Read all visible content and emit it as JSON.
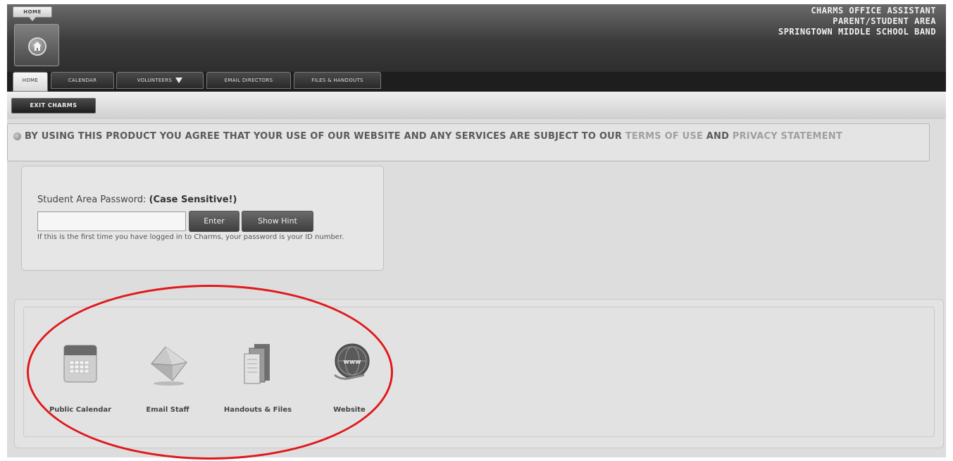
{
  "header": {
    "home_tab_label": "HOME",
    "title_lines": [
      "CHARMS OFFICE ASSISTANT",
      "PARENT/STUDENT AREA",
      "SPRINGTOWN MIDDLE SCHOOL BAND"
    ]
  },
  "nav": {
    "tabs": [
      {
        "label": "HOME",
        "active": true
      },
      {
        "label": "CALENDAR",
        "active": false
      },
      {
        "label": "VOLUNTEERS",
        "active": false
      },
      {
        "label": "EMAIL DIRECTORS",
        "active": false
      },
      {
        "label": "FILES & HANDOUTS",
        "active": false
      }
    ]
  },
  "subbar": {
    "exit_label": "EXIT CHARMS"
  },
  "notice": {
    "text_before": "BY USING THIS PRODUCT YOU AGREE THAT YOUR USE OF OUR WEBSITE AND ANY SERVICES ARE SUBJECT TO OUR ",
    "terms_link": "TERMS OF USE",
    "and_text": " AND ",
    "privacy_link": "PRIVACY STATEMENT"
  },
  "password": {
    "label": "Student Area Password:",
    "label_emphasis": "(Case Sensitive!)",
    "value": "",
    "enter_label": "Enter",
    "hint_label": "Show Hint",
    "hint_text": "If this is the first time you have logged in to Charms, your password is your ID number."
  },
  "quick_links": [
    {
      "label": "Public Calendar",
      "icon": "calendar-icon"
    },
    {
      "label": "Email Staff",
      "icon": "envelope-icon"
    },
    {
      "label": "Handouts & Files",
      "icon": "files-icon"
    },
    {
      "label": "Website",
      "icon": "globe-icon"
    }
  ],
  "annotation": {
    "color": "#e0191c"
  }
}
